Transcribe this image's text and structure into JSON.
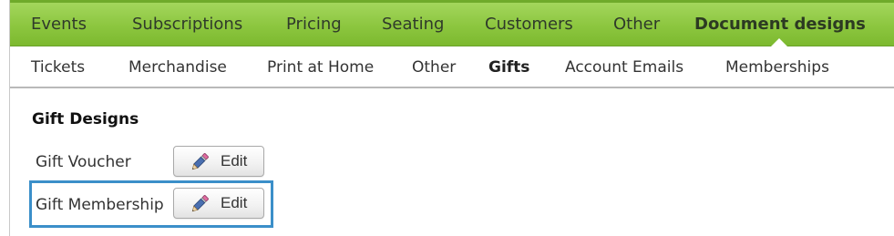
{
  "top_nav": {
    "items": [
      {
        "label": "Events"
      },
      {
        "label": "Subscriptions"
      },
      {
        "label": "Pricing"
      },
      {
        "label": "Seating"
      },
      {
        "label": "Customers"
      },
      {
        "label": "Other"
      },
      {
        "label": "Document designs",
        "active": true
      }
    ]
  },
  "sub_nav": {
    "items": [
      {
        "label": "Tickets"
      },
      {
        "label": "Merchandise"
      },
      {
        "label": "Print at Home"
      },
      {
        "label": "Other"
      },
      {
        "label": "Gifts",
        "active": true
      },
      {
        "label": "Account Emails"
      },
      {
        "label": "Memberships"
      }
    ]
  },
  "main": {
    "section_title": "Gift Designs",
    "rows": [
      {
        "label": "Gift Voucher",
        "button_label": "Edit",
        "icon": "pencil-icon"
      },
      {
        "label": "Gift Membership",
        "button_label": "Edit",
        "icon": "pencil-icon",
        "highlighted": true
      }
    ]
  },
  "colors": {
    "nav_green": "#8cc63f",
    "highlight_blue": "#3b8fc9"
  }
}
